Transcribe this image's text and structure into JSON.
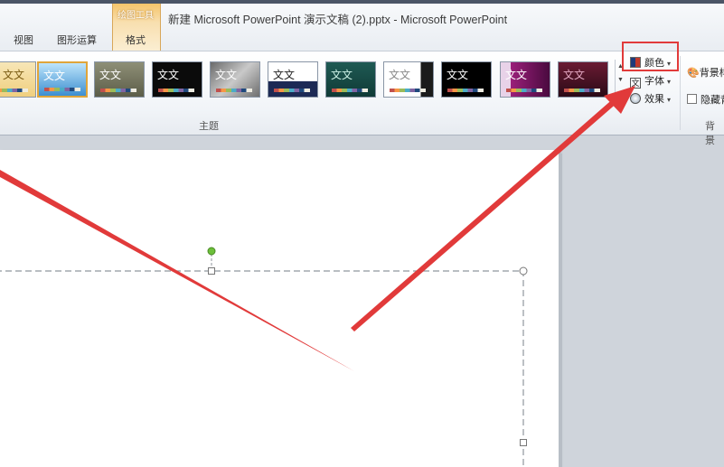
{
  "window": {
    "title": "新建 Microsoft PowerPoint 演示文稿 (2).pptx - Microsoft PowerPoint",
    "context_group_label": "绘图工具"
  },
  "tabs": [
    "视图",
    "图形运算",
    "格式"
  ],
  "ribbon": {
    "themes": [
      {
        "label": "文文"
      },
      {
        "label": "文文"
      },
      {
        "label": "文文"
      },
      {
        "label": "文文"
      },
      {
        "label": "文文"
      },
      {
        "label": "文文"
      },
      {
        "label": "文文"
      },
      {
        "label": "文文"
      },
      {
        "label": "文文"
      },
      {
        "label": "文文"
      },
      {
        "label": "文文"
      }
    ],
    "theme_group_label": "主题",
    "colors_label": "颜色",
    "fonts_label": "字体",
    "effects_label": "效果",
    "font_icon_glyph": "文",
    "background_styles_label": "背景样",
    "hide_background_label": "隐藏背",
    "background_group_label": "背景"
  },
  "colors": {
    "annotation_red": "#e13a3a",
    "handle_green": "#6cbf3a"
  }
}
